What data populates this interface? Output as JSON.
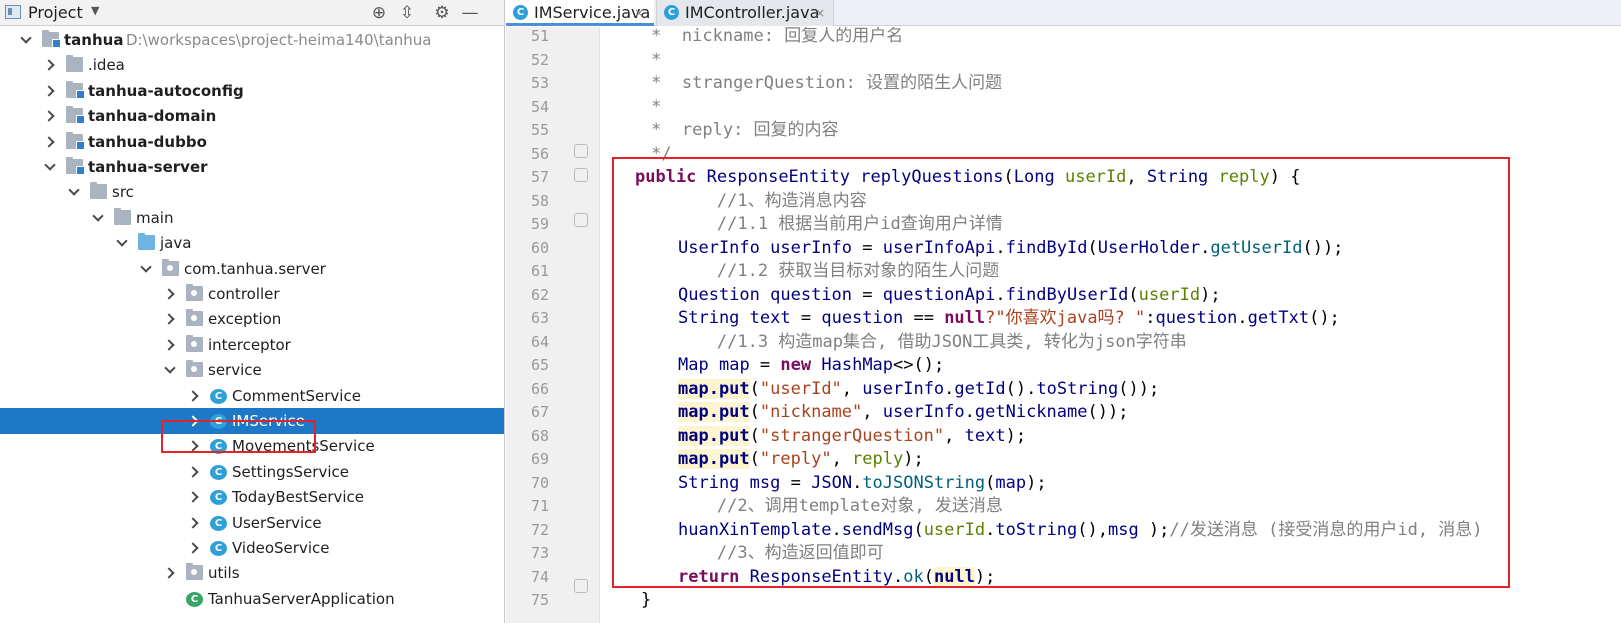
{
  "project_panel": {
    "title": "Project",
    "tree": [
      {
        "label": "tanhua",
        "path": "D:\\workspaces\\project-heima140\\tanhua",
        "depth": 0,
        "expand": "down",
        "icon": "module-folder",
        "bold": true
      },
      {
        "label": ".idea",
        "depth": 1,
        "expand": "right",
        "icon": "folder"
      },
      {
        "label": "tanhua-autoconfig",
        "depth": 1,
        "expand": "right",
        "icon": "module-folder",
        "bold": true
      },
      {
        "label": "tanhua-domain",
        "depth": 1,
        "expand": "right",
        "icon": "module-folder",
        "bold": true
      },
      {
        "label": "tanhua-dubbo",
        "depth": 1,
        "expand": "right",
        "icon": "module-folder",
        "bold": true
      },
      {
        "label": "tanhua-server",
        "depth": 1,
        "expand": "down",
        "icon": "module-folder",
        "bold": true
      },
      {
        "label": "src",
        "depth": 2,
        "expand": "down",
        "icon": "folder"
      },
      {
        "label": "main",
        "depth": 3,
        "expand": "down",
        "icon": "folder"
      },
      {
        "label": "java",
        "depth": 4,
        "expand": "down",
        "icon": "source-folder"
      },
      {
        "label": "com.tanhua.server",
        "depth": 5,
        "expand": "down",
        "icon": "package"
      },
      {
        "label": "controller",
        "depth": 6,
        "expand": "right",
        "icon": "package"
      },
      {
        "label": "exception",
        "depth": 6,
        "expand": "right",
        "icon": "package"
      },
      {
        "label": "interceptor",
        "depth": 6,
        "expand": "right",
        "icon": "package"
      },
      {
        "label": "service",
        "depth": 6,
        "expand": "down",
        "icon": "package"
      },
      {
        "label": "CommentService",
        "depth": 7,
        "expand": "right",
        "icon": "class"
      },
      {
        "label": "IMService",
        "depth": 7,
        "expand": "right",
        "icon": "class",
        "selected": true
      },
      {
        "label": "MovementsService",
        "depth": 7,
        "expand": "right",
        "icon": "class"
      },
      {
        "label": "SettingsService",
        "depth": 7,
        "expand": "right",
        "icon": "class"
      },
      {
        "label": "TodayBestService",
        "depth": 7,
        "expand": "right",
        "icon": "class"
      },
      {
        "label": "UserService",
        "depth": 7,
        "expand": "right",
        "icon": "class"
      },
      {
        "label": "VideoService",
        "depth": 7,
        "expand": "right",
        "icon": "class"
      },
      {
        "label": "utils",
        "depth": 6,
        "expand": "right",
        "icon": "package"
      },
      {
        "label": "TanhuaServerApplication",
        "depth": 6,
        "expand": "none",
        "icon": "app-class"
      }
    ]
  },
  "editor": {
    "tabs": [
      {
        "label": "IMService.java",
        "active": true
      },
      {
        "label": "IMController.java",
        "active": false
      }
    ],
    "class_icon_letter": "C",
    "close_glyph": "×",
    "line_numbers": [
      "51",
      "52",
      "53",
      "54",
      "55",
      "56",
      "57",
      "58",
      "59",
      "60",
      "61",
      "62",
      "63",
      "64",
      "65",
      "66",
      "67",
      "68",
      "69",
      "70",
      "71",
      "72",
      "73",
      "74",
      "75"
    ],
    "code": {
      "l51": "     *  nickname: 回复人的用户名",
      "l52": "     *",
      "l53_a": "     *  ",
      "l53_b": "strangerQuestion",
      "l53_c": ": 设置的陌生人问题",
      "l54": "     *",
      "l55_a": "     *  ",
      "l55_b": "reply",
      "l55_c": ": 回复的内容",
      "l56": "     */",
      "l57_kw": "public",
      "l57_type": "ResponseEntity",
      "l57_fn": "replyQuestions",
      "l57_open": "(",
      "l57_t1": "Long",
      "l57_p1": "userId",
      "l57_comma": ", ",
      "l57_t2": "String",
      "l57_p2": "reply",
      "l57_close": ") {",
      "l58": "        //1、构造消息内容",
      "l59": "        //1.1 根据当前用户id查询用户详情",
      "l60_t": "UserInfo",
      "l60_v": "userInfo",
      "l60_eq": " = ",
      "l60_api": "userInfoApi",
      "l60_dot": ".",
      "l60_fn": "findById",
      "l60_open": "(",
      "l60_cls": "UserHolder",
      "l60_fn2": "getUserId",
      "l60_end": "());",
      "l61": "        //1.2 获取当目标对象的陌生人问题",
      "l62_t": "Question",
      "l62_v": "question",
      "l62_api": "questionApi",
      "l62_fn": "findByUserId",
      "l62_arg": "userId",
      "l62_end": ");",
      "l63_t": "String",
      "l63_v": "text",
      "l63_q": "question",
      "l63_op": " == ",
      "l63_null": "null",
      "l63_str": "?\"你喜欢java吗? \"",
      "l63_colon": ":",
      "l63_fn": "getTxt",
      "l63_end": "();",
      "l64": "        //1.3 构造map集合, 借助JSON工具类, 转化为json字符串",
      "l65_t": "Map",
      "l65_v": "map",
      "l65_new": "new",
      "l65_cls": "HashMap",
      "l65_end": "<>();",
      "l66_m": "map.put",
      "l66_s": "\"userId\"",
      "l66_v": "userInfo",
      "l66_fn": "getId",
      "l66_fn2": "toString",
      "l66_end": "());",
      "l67_m": "map.put",
      "l67_s": "\"nickname\"",
      "l67_v": "userInfo",
      "l67_fn": "getNickname",
      "l67_end": "());",
      "l68_m": "map.put",
      "l68_s": "\"strangerQuestion\"",
      "l68_v": "text",
      "l68_end": ");",
      "l69_m": "map.put",
      "l69_s": "\"reply\"",
      "l69_v": "reply",
      "l69_end": ");",
      "l70_t": "String",
      "l70_v": "msg",
      "l70_cls": "JSON",
      "l70_fn": "toJSONString",
      "l70_arg": "map",
      "l70_end": ");",
      "l71": "        //2、调用template对象, 发送消息",
      "l72_obj": "huanXinTemplate",
      "l72_fn": "sendMsg",
      "l72_a1": "userId",
      "l72_fn2": "toString",
      "l72_mid": "(),",
      "l72_a2": "msg",
      "l72_end": " );",
      "l72_cm": "//发送消息 (接受消息的用户id, 消息)",
      "l73": "        //3、构造返回值即可",
      "l74_kw": "return",
      "l74_cls": "ResponseEntity",
      "l74_fn": "ok",
      "l74_null": "null",
      "l74_end": ");",
      "l75": "    }"
    }
  },
  "colors": {
    "selection": "#1e78c8",
    "highlight_box": "#e0242a",
    "keyword": "#000080",
    "comment": "#808080"
  }
}
